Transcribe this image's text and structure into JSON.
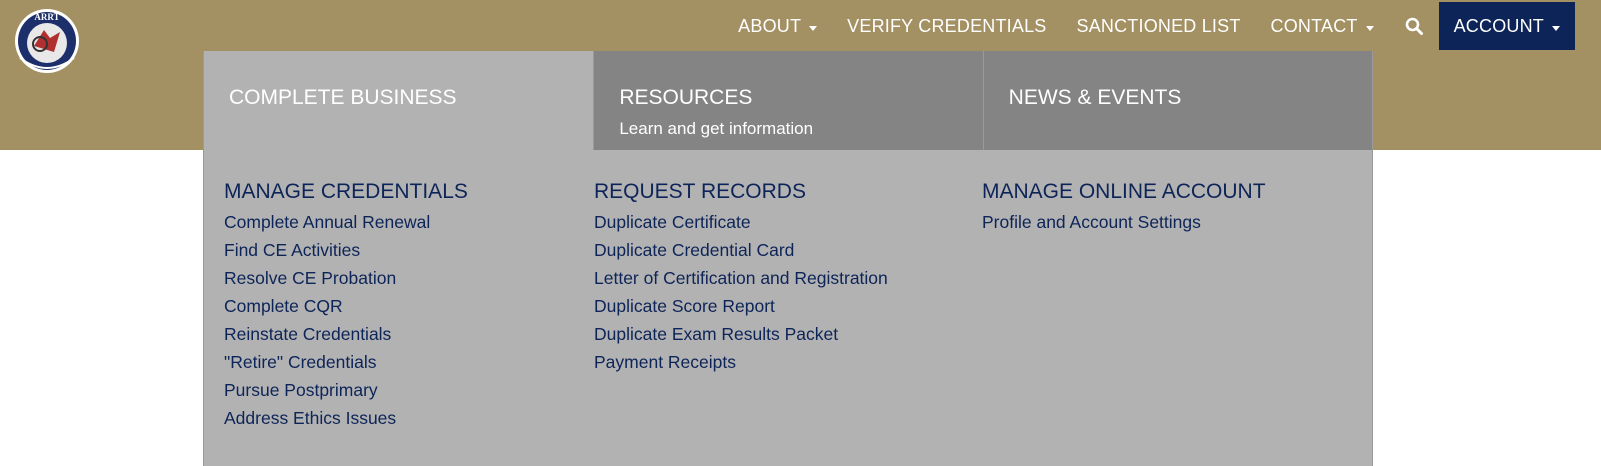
{
  "logo": {
    "text": "ARRT"
  },
  "topnav": {
    "about": "ABOUT",
    "verify": "VERIFY CREDENTIALS",
    "sanctioned": "SANCTIONED LIST",
    "contact": "CONTACT",
    "account": "ACCOUNT"
  },
  "tabs": {
    "complete_business": {
      "title": "COMPLETE BUSINESS"
    },
    "resources": {
      "title": "RESOURCES",
      "subtitle": "Learn and get information"
    },
    "news_events": {
      "title": "NEWS & EVENTS"
    }
  },
  "columns": {
    "manage_credentials": {
      "heading": "MANAGE CREDENTIALS",
      "links": [
        "Complete Annual Renewal",
        "Find CE Activities",
        "Resolve CE Probation",
        "Complete CQR",
        "Reinstate Credentials",
        "\"Retire\" Credentials",
        "Pursue Postprimary",
        "Address Ethics Issues"
      ]
    },
    "request_records": {
      "heading": "REQUEST RECORDS",
      "links": [
        "Duplicate Certificate",
        "Duplicate Credential Card",
        "Letter of Certification and Registration",
        "Duplicate Score Report",
        "Duplicate Exam Results Packet",
        "Payment Receipts"
      ]
    },
    "manage_online_account": {
      "heading": "MANAGE ONLINE ACCOUNT",
      "links": [
        "Profile and Account Settings"
      ]
    }
  },
  "colors": {
    "header_bg": "#a39063",
    "menu_bg": "#b2b2b2",
    "tab_inactive_bg": "#848484",
    "accent_navy": "#0d2458"
  },
  "icons": {
    "logo": "arrt-seal-logo",
    "search": "search-icon",
    "caret": "caret-down-icon"
  }
}
